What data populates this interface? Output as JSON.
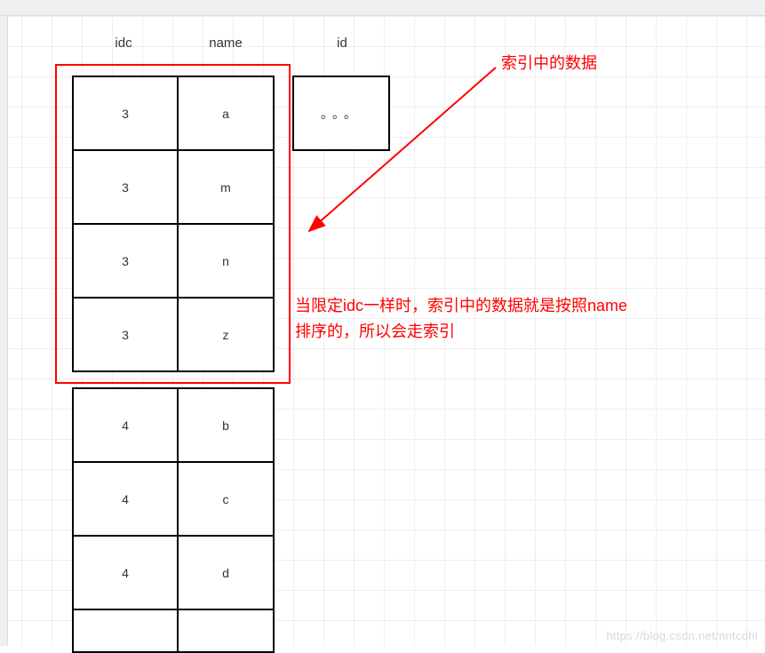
{
  "headers": {
    "idc": "idc",
    "name": "name",
    "id": "id"
  },
  "ellipsis": "。。。",
  "rows": [
    {
      "idc": "3",
      "name": "a"
    },
    {
      "idc": "3",
      "name": "m"
    },
    {
      "idc": "3",
      "name": "n"
    },
    {
      "idc": "3",
      "name": "z"
    },
    {
      "idc": "4",
      "name": "b"
    },
    {
      "idc": "4",
      "name": "c"
    },
    {
      "idc": "4",
      "name": "d"
    }
  ],
  "annotations": {
    "top": "索引中的数据",
    "middle_line1": "当限定idc一样时，索引中的数据就是按照name",
    "middle_line2": "排序的，所以会走索引"
  },
  "watermark": "https://blog.csdn.net/nntcdhl"
}
